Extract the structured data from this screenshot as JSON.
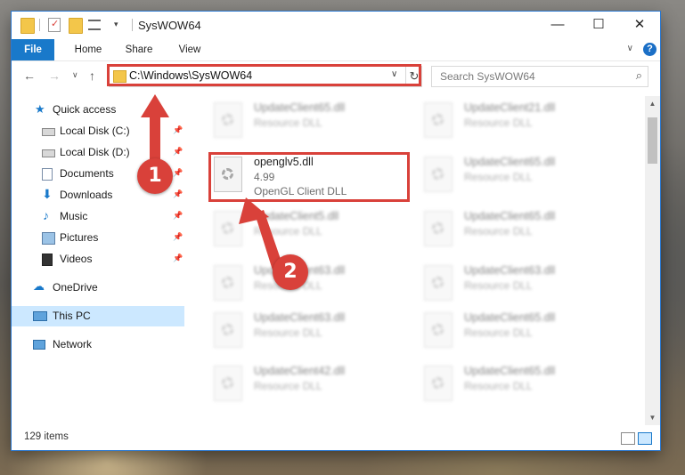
{
  "window": {
    "title": "SysWOW64",
    "minimize": "—",
    "maximize": "☐",
    "close": "✕"
  },
  "ribbon": {
    "tabs": [
      "File",
      "Home",
      "Share",
      "View"
    ],
    "help": "?"
  },
  "address": {
    "path": "C:\\Windows\\SysWOW64",
    "search_placeholder": "Search SysWOW64"
  },
  "sidebar": {
    "items": [
      {
        "label": "Quick access",
        "icon": "star-icon"
      },
      {
        "label": "Local Disk (C:)",
        "icon": "drive-icon",
        "pinned": true
      },
      {
        "label": "Local Disk (D:)",
        "icon": "drive-icon",
        "pinned": true
      },
      {
        "label": "Documents",
        "icon": "documents-icon",
        "pinned": true
      },
      {
        "label": "Downloads",
        "icon": "download-icon",
        "pinned": true
      },
      {
        "label": "Music",
        "icon": "music-icon",
        "pinned": true
      },
      {
        "label": "Pictures",
        "icon": "pictures-icon",
        "pinned": true
      },
      {
        "label": "Videos",
        "icon": "videos-icon",
        "pinned": true
      },
      {
        "label": "OneDrive",
        "icon": "cloud-icon"
      },
      {
        "label": "This PC",
        "icon": "computer-icon",
        "selected": true
      },
      {
        "label": "Network",
        "icon": "network-icon"
      }
    ]
  },
  "files": {
    "highlighted": {
      "name": "openglv5.dll",
      "version": "4.99",
      "description": "OpenGL Client DLL"
    },
    "left_column": [
      {
        "name": "UpdateClient65.dll",
        "type": "Resource DLL"
      },
      {
        "name": "UpdateClient5.dll",
        "type": "Resource DLL"
      },
      {
        "name": "UpdateClient63.dll",
        "type": "Resource DLL"
      },
      {
        "name": "UpdateClient63.dll",
        "type": "Resource DLL"
      },
      {
        "name": "UpdateClient42.dll",
        "type": "Resource DLL"
      }
    ],
    "right_column": [
      {
        "name": "UpdateClient21.dll",
        "type": "Resource DLL"
      },
      {
        "name": "UpdateClient65.dll",
        "type": "Resource DLL"
      },
      {
        "name": "UpdateClient65.dll",
        "type": "Resource DLL"
      },
      {
        "name": "UpdateClient63.dll",
        "type": "Resource DLL"
      },
      {
        "name": "UpdateClient65.dll",
        "type": "Resource DLL"
      },
      {
        "name": "UpdateClient65.dll",
        "type": "Resource DLL"
      }
    ]
  },
  "status": {
    "item_count": "129 items"
  },
  "annotations": {
    "step1": "1",
    "step2": "2",
    "color": "#d9413a"
  }
}
